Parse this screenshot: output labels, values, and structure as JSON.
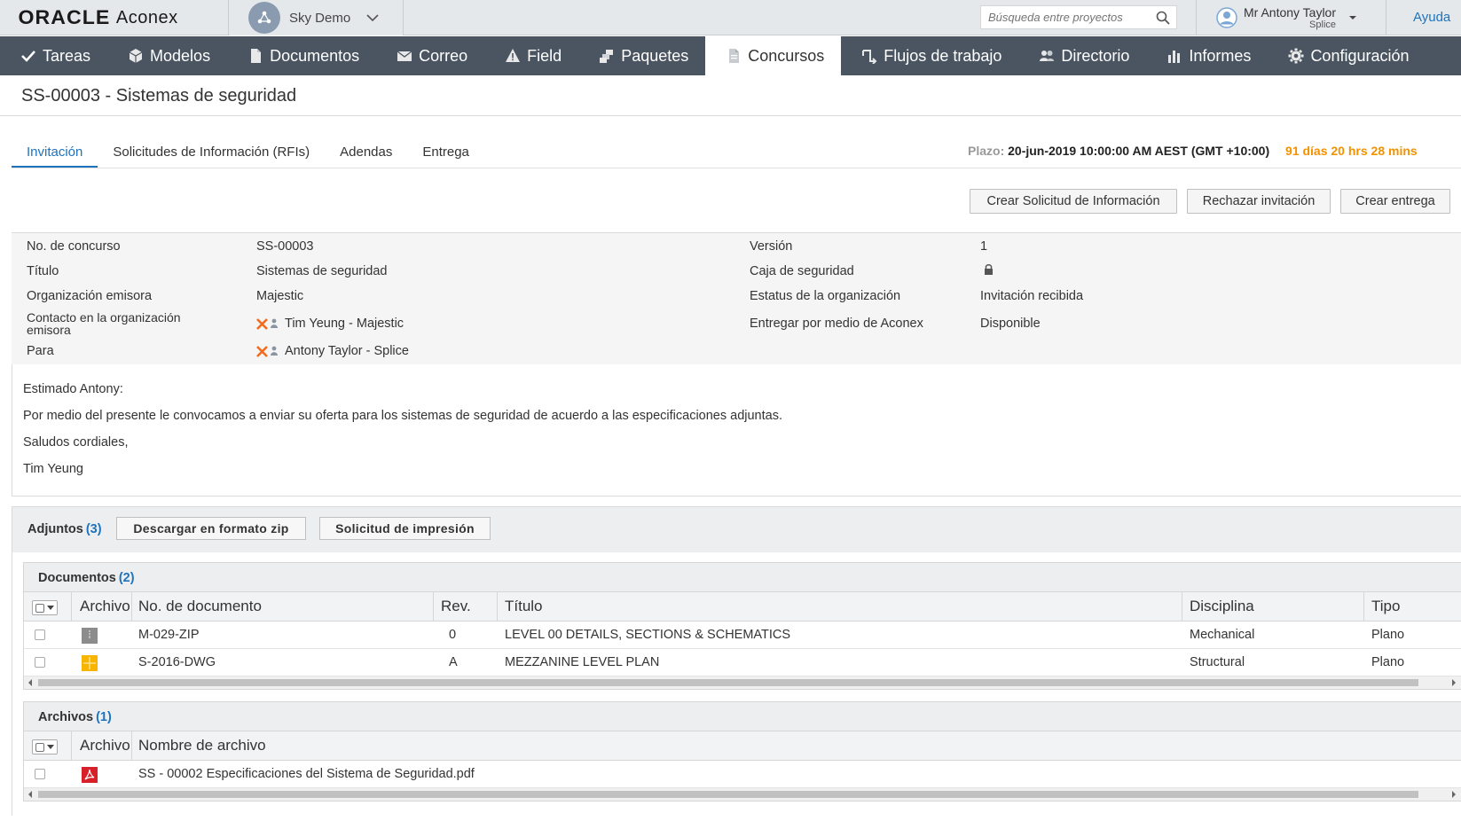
{
  "brand": {
    "oracle": "ORACLE",
    "product": "Aconex"
  },
  "project": {
    "name": "Sky Demo"
  },
  "search": {
    "placeholder": "Búsqueda entre proyectos"
  },
  "user": {
    "name": "Mr Antony Taylor",
    "org": "Splice"
  },
  "help": "Ayuda",
  "nav": [
    {
      "label": "Tareas",
      "icon": "check-icon"
    },
    {
      "label": "Modelos",
      "icon": "cube-icon"
    },
    {
      "label": "Documentos",
      "icon": "document-icon"
    },
    {
      "label": "Correo",
      "icon": "envelope-icon"
    },
    {
      "label": "Field",
      "icon": "warning-triangle-icon"
    },
    {
      "label": "Paquetes",
      "icon": "packages-icon"
    },
    {
      "label": "Concursos",
      "icon": "tender-document-icon",
      "active": true
    },
    {
      "label": "Flujos de trabajo",
      "icon": "workflow-icon"
    },
    {
      "label": "Directorio",
      "icon": "people-icon"
    },
    {
      "label": "Informes",
      "icon": "bar-chart-icon"
    },
    {
      "label": "Configuración",
      "icon": "gear-icon"
    }
  ],
  "page": {
    "title": "SS-00003 - Sistemas de seguridad"
  },
  "tabs": [
    {
      "label": "Invitación",
      "active": true
    },
    {
      "label": "Solicitudes de Información (RFIs)"
    },
    {
      "label": "Adendas"
    },
    {
      "label": "Entrega"
    }
  ],
  "deadline": {
    "label": "Plazo:",
    "value": "20-jun-2019 10:00:00 AM AEST (GMT +10:00)",
    "remaining": "91 días 20 hrs 28 mins"
  },
  "actions": {
    "create_rfi": "Crear Solicitud de Información",
    "reject": "Rechazar invitación",
    "create_submission": "Crear entrega"
  },
  "details": {
    "tender_no_label": "No. de concurso",
    "tender_no": "SS-00003",
    "title_label": "Título",
    "title": "Sistemas de seguridad",
    "issuing_org_label": "Organización emisora",
    "issuing_org": "Majestic",
    "contact_label_1": "Contacto en la organización",
    "contact_label_2": "emisora",
    "contact": "Tim Yeung - Majestic",
    "to_label": "Para",
    "to": "Antony Taylor - Splice",
    "version_label": "Versión",
    "version": "1",
    "lockbox_label": "Caja de seguridad",
    "org_status_label": "Estatus de la organización",
    "org_status": "Invitación recibida",
    "submit_via_label": "Entregar por medio de Aconex",
    "submit_via": "Disponible"
  },
  "message": {
    "greeting": "Estimado Antony:",
    "body": "Por medio del presente le convocamos a enviar su oferta para los sistemas de seguridad de acuerdo a las especificaciones adjuntas.",
    "closing": "Saludos cordiales,",
    "signature": "Tim Yeung"
  },
  "attachments": {
    "label": "Adjuntos",
    "count": "(3)",
    "download_zip": "Descargar en formato zip",
    "print_request": "Solicitud de impresión"
  },
  "documents": {
    "label": "Documentos",
    "count": "(2)",
    "columns": {
      "file": "Archivo",
      "doc_no": "No. de documento",
      "rev": "Rev.",
      "title": "Título",
      "discipline": "Disciplina",
      "type": "Tipo"
    },
    "rows": [
      {
        "doc_no": "M-029-ZIP",
        "rev": "0",
        "title": "LEVEL 00 DETAILS, SECTIONS & SCHEMATICS",
        "discipline": "Mechanical",
        "type": "Plano",
        "file_icon": "zip-file-icon"
      },
      {
        "doc_no": "S-2016-DWG",
        "rev": "A",
        "title": "MEZZANINE LEVEL PLAN",
        "discipline": "Structural",
        "type": "Plano",
        "file_icon": "dwg-file-icon"
      }
    ]
  },
  "files": {
    "label": "Archivos",
    "count": "(1)",
    "columns": {
      "file": "Archivo",
      "filename": "Nombre de archivo"
    },
    "rows": [
      {
        "filename": "SS - 00002 Especificaciones del Sistema de Seguridad.pdf",
        "file_icon": "pdf-file-icon"
      }
    ]
  },
  "colors": {
    "nav_bg": "#4a5561",
    "accent": "#1e73be",
    "deadline_remaining": "#f39200"
  }
}
